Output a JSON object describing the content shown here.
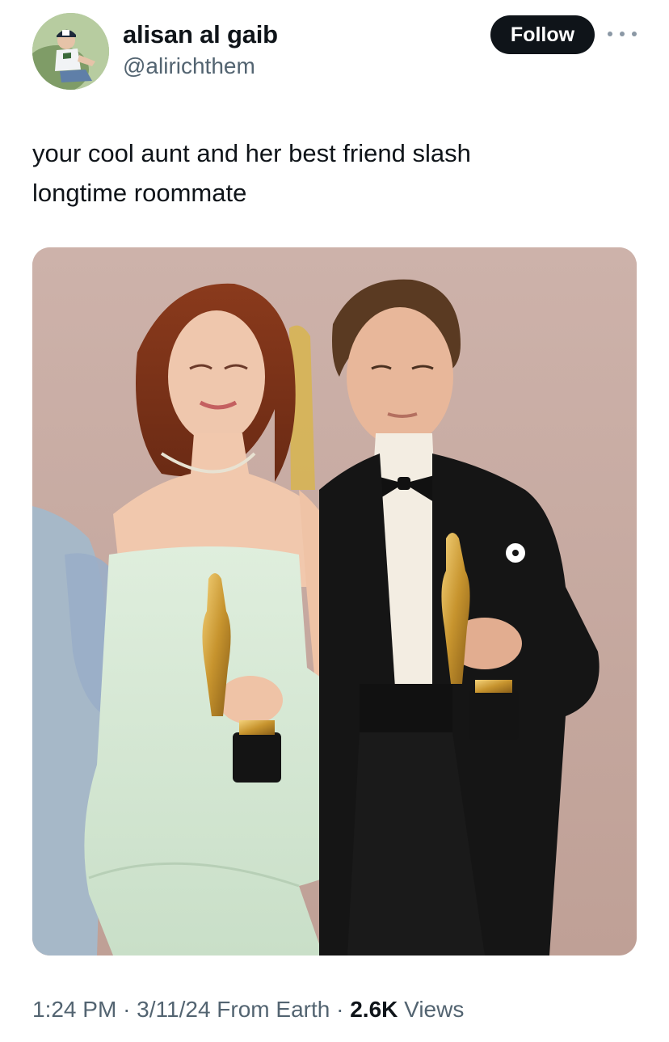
{
  "author": {
    "display_name": "alisan al gaib",
    "handle": "@alirichthem"
  },
  "actions": {
    "follow_label": "Follow"
  },
  "tweet": {
    "text_line_1": "your cool aunt and her best friend slash",
    "text_line_2": "longtime roommate"
  },
  "meta": {
    "time": "1:24 PM",
    "separator": "·",
    "date": "3/11/24",
    "source": "From Earth",
    "views_count": "2.6K",
    "views_label": "Views"
  },
  "icons": {
    "more": "more-horizontal-icon",
    "avatar": "avatar-image"
  },
  "colors": {
    "text_primary": "#0f1419",
    "text_secondary": "#536471",
    "follow_button_bg": "#0f1419",
    "follow_button_text": "#ffffff",
    "photo_backdrop": "#c9aea6"
  }
}
